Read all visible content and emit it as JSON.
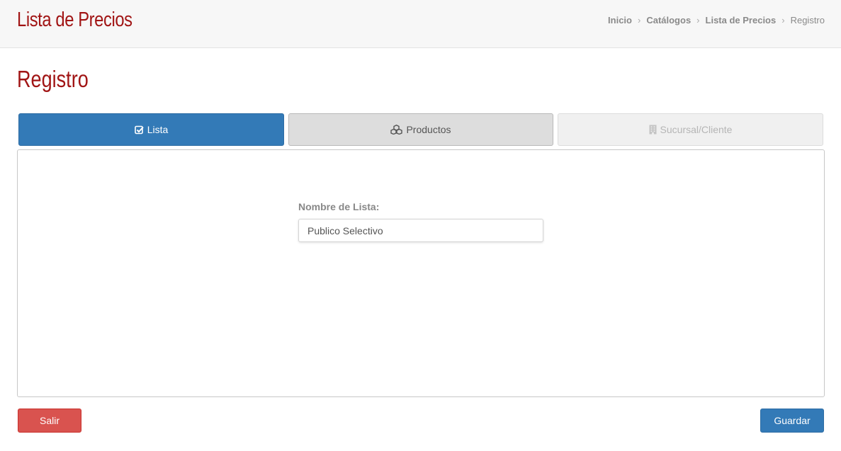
{
  "header": {
    "title": "Lista de Precios",
    "breadcrumb": {
      "items": [
        "Inicio",
        "Catálogos",
        "Lista de Precios"
      ],
      "current": "Registro",
      "separator": "›"
    }
  },
  "page": {
    "heading": "Registro"
  },
  "tabs": [
    {
      "label": "Lista",
      "icon": "check-square-icon",
      "state": "active"
    },
    {
      "label": "Productos",
      "icon": "cubes-icon",
      "state": "default"
    },
    {
      "label": "Sucursal/Cliente",
      "icon": "building-icon",
      "state": "disabled"
    }
  ],
  "form": {
    "nombre_label": "Nombre de Lista:",
    "nombre_value": "Publico Selectivo"
  },
  "actions": {
    "exit_label": "Salir",
    "save_label": "Guardar"
  },
  "colors": {
    "brand_red": "#a11515",
    "primary": "#337ab7",
    "danger": "#d9534f"
  }
}
